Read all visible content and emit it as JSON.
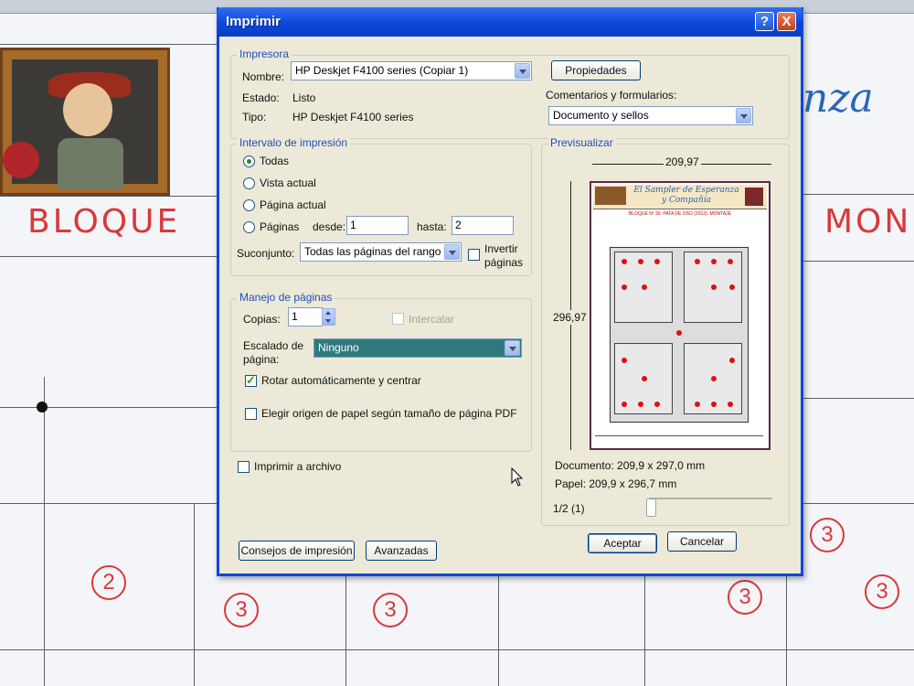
{
  "background": {
    "label_left": "BLOQUE",
    "label_right": "MON",
    "script_text": "nza",
    "circle_numbers": [
      "2",
      "3",
      "3",
      "3",
      "3",
      "3"
    ]
  },
  "dialog": {
    "title": "Imprimir",
    "help_symbol": "?",
    "close_symbol": "X",
    "printer": {
      "group_label": "Impresora",
      "name_label": "Nombre:",
      "name_value": "HP Deskjet F4100 series (Copiar 1)",
      "status_label": "Estado:",
      "status_value": "Listo",
      "type_label": "Tipo:",
      "type_value": "HP Deskjet F4100 series",
      "properties_button": "Propiedades",
      "comments_label": "Comentarios y formularios:",
      "comments_value": "Documento y sellos"
    },
    "range": {
      "group_label": "Intervalo de impresión",
      "all": "Todas",
      "current_view": "Vista actual",
      "current_page": "Página actual",
      "pages": "Páginas",
      "from_label": "desde:",
      "from_value": "1",
      "to_label": "hasta:",
      "to_value": "2",
      "subset_label": "Suconjunto:",
      "subset_value": "Todas las páginas del rango",
      "reverse_line1": "Invertir",
      "reverse_line2": "páginas"
    },
    "handling": {
      "group_label": "Manejo de páginas",
      "copies_label": "Copias:",
      "copies_value": "1",
      "collate": "Intercalar",
      "scaling_label_line1": "Escalado de",
      "scaling_label_line2": "página:",
      "scaling_value": "Ninguno",
      "auto_rotate": "Rotar automáticamente y centrar",
      "choose_source": "Elegir origen de papel según tamaño de página PDF"
    },
    "print_to_file": "Imprimir a archivo",
    "preview": {
      "group_label": "Previsualizar",
      "width": "209,97",
      "height": "296,97",
      "page_header_line1": "El Sampler de Esperanza",
      "page_header_line2": "y Compañía",
      "page_subtitle": "BLOQUE Nº 30: PATA DE OSO (2013). MONTAJE",
      "document_label": "Documento: 209,9 x 297,0 mm",
      "paper_label": "Papel: 209,9 x 296,7 mm",
      "page_counter": "1/2 (1)"
    },
    "buttons": {
      "tips": "Consejos de impresión",
      "advanced": "Avanzadas",
      "ok": "Aceptar",
      "cancel": "Cancelar"
    }
  }
}
